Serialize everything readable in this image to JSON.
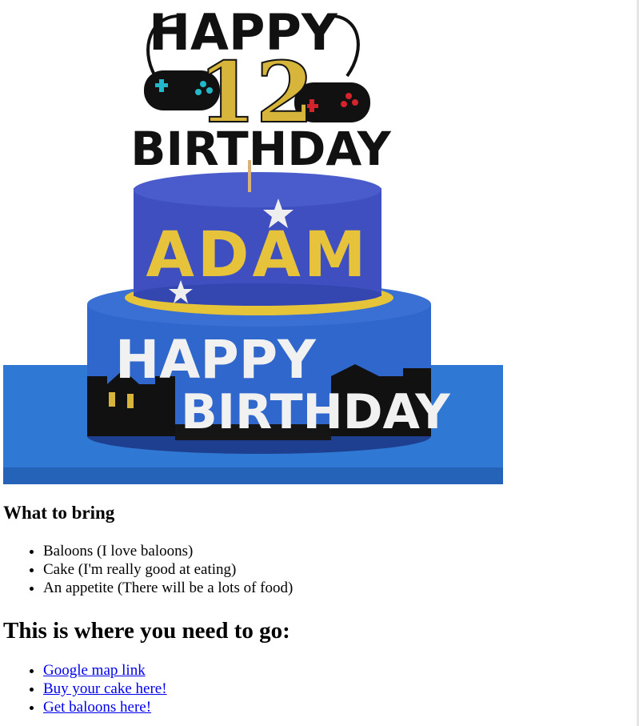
{
  "image": {
    "alt": "",
    "topper_text_top": "HAPPY",
    "topper_number": "12",
    "topper_text_bottom": "BIRTHDAY",
    "cake_name": "ADAM",
    "cake_greeting_1": "HAPPY",
    "cake_greeting_2": "BIRTHDAY",
    "colors": {
      "cake_blue_top": "#3f4fbf",
      "cake_blue_bottom": "#2f67cc",
      "board_blue": "#2f78d4",
      "gold": "#d7b53a",
      "topper_black": "#111111"
    }
  },
  "bring": {
    "heading": "What to bring",
    "items": [
      "Baloons (I love baloons)",
      "Cake (I'm really good at eating)",
      "An appetite (There will be a lots of food)"
    ]
  },
  "directions": {
    "heading": "This is where you need to go:",
    "links": [
      "Google map link",
      "Buy your cake here!",
      "Get baloons here!"
    ]
  }
}
